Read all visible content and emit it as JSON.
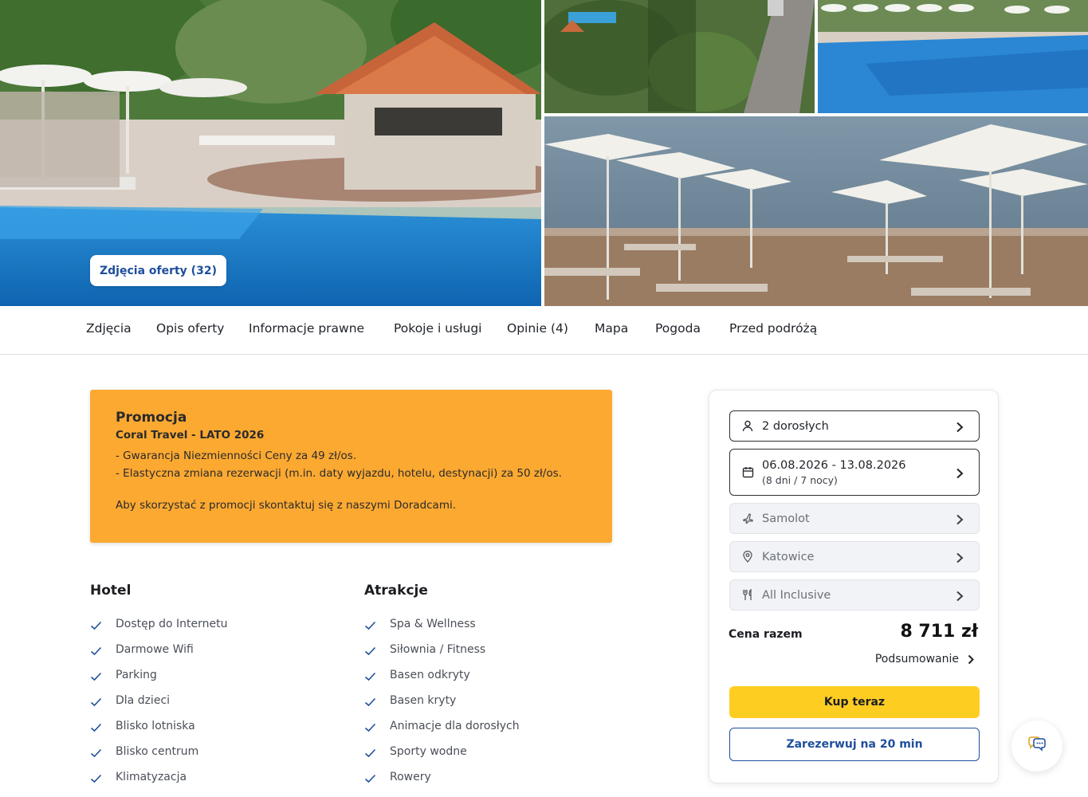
{
  "gallery": {
    "photos_button_label": "Zdjęcia oferty (32)"
  },
  "tabs": [
    {
      "label": "Zdjęcia"
    },
    {
      "label": "Opis oferty"
    },
    {
      "label": "Informacje prawne"
    },
    {
      "label": "Pokoje i usługi"
    },
    {
      "label": "Opinie (4)"
    },
    {
      "label": "Mapa"
    },
    {
      "label": "Pogoda"
    },
    {
      "label": "Przed podróżą"
    }
  ],
  "promo": {
    "title": "Promocja",
    "subtitle": "Coral Travel - LATO 2026",
    "lines": [
      "- Gwarancja Niezmienności Ceny za 49 zł/os.",
      "- Elastyczna zmiana rezerwacji (m.in. daty wyjazdu, hotelu, destynacji) za 50 zł/os."
    ],
    "note": "Aby skorzystać z promocji skontaktuj się z naszymi Doradcami."
  },
  "features": {
    "hotel": {
      "title": "Hotel",
      "items": [
        "Dostęp do Internetu",
        "Darmowe Wifi",
        "Parking",
        "Dla dzieci",
        "Blisko lotniska",
        "Blisko centrum",
        "Klimatyzacja"
      ]
    },
    "attractions": {
      "title": "Atrakcje",
      "items": [
        "Spa & Wellness",
        "Siłownia / Fitness",
        "Basen odkryty",
        "Basen kryty",
        "Animacje dla dorosłych",
        "Sporty wodne",
        "Rowery"
      ]
    }
  },
  "booking": {
    "travelers": {
      "label": "2 dorosłych",
      "icon": "person-icon"
    },
    "dates": {
      "label": "06.08.2026 - 13.08.2026",
      "sub": "(8 dni / 7 nocy)",
      "icon": "calendar-icon"
    },
    "transport": {
      "label": "Samolot",
      "icon": "plane-icon"
    },
    "departure": {
      "label": "Katowice",
      "icon": "location-pin-icon"
    },
    "board": {
      "label": "All Inclusive",
      "icon": "fork-knife-icon"
    },
    "total_label": "Cena razem",
    "total_value": "8 711 zł",
    "summary_label": "Podsumowanie",
    "buy_label": "Kup teraz",
    "reserve_label": "Zarezerwuj na 20 min"
  },
  "colors": {
    "promo_bg": "#fca932",
    "buy_button": "#fecd22",
    "brand_blue": "#1e4f9c",
    "check_blue": "#1e4f9c"
  }
}
